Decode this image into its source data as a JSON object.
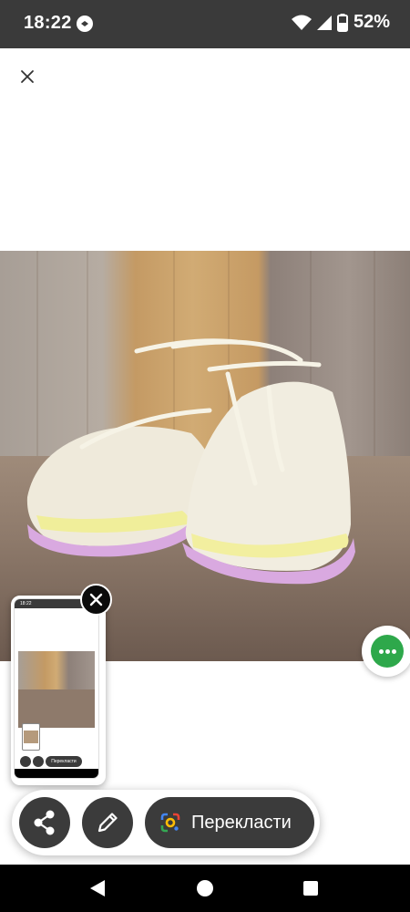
{
  "status_bar": {
    "time": "18:22",
    "battery_percent": "52%",
    "icons": [
      "app-notification-icon",
      "wifi-icon",
      "signal-icon",
      "battery-icon"
    ]
  },
  "preview": {
    "close_icon": "close-icon",
    "more_icon": "more-options-icon",
    "more_color": "#2ea84b"
  },
  "thumbnail": {
    "status_time": "18:22",
    "translate_label": "Перекласти",
    "close_icon": "close-icon"
  },
  "actions": {
    "share_icon": "share-icon",
    "edit_icon": "pencil-icon",
    "translate_icon": "google-lens-icon",
    "translate_label": "Перекласти"
  },
  "nav": {
    "icons": [
      "back-icon",
      "home-icon",
      "recents-icon"
    ]
  }
}
